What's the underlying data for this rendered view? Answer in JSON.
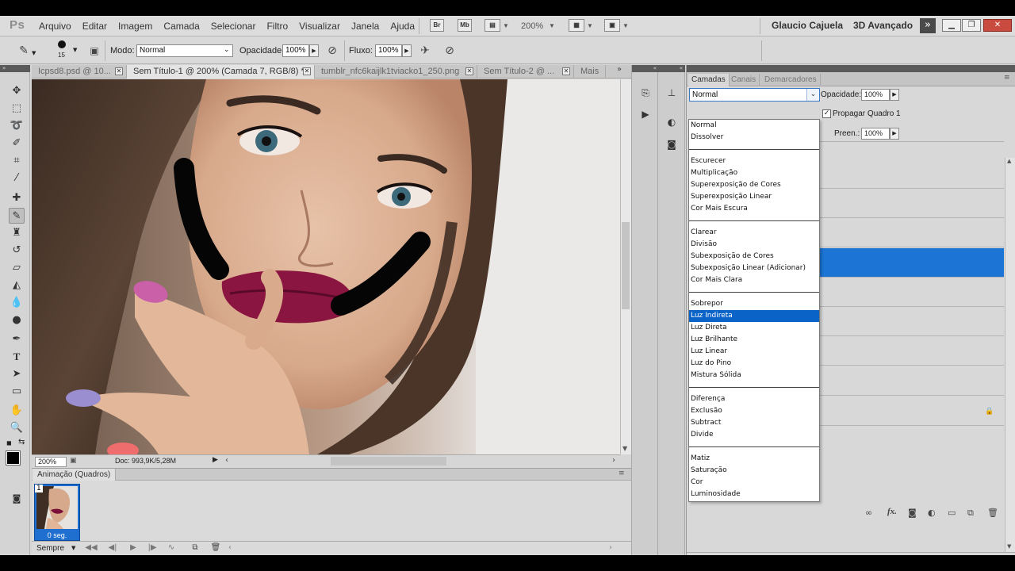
{
  "app": {
    "logo": "Ps"
  },
  "menubar": {
    "items": [
      "Arquivo",
      "Editar",
      "Imagem",
      "Camada",
      "Selecionar",
      "Filtro",
      "Visualizar",
      "Janela",
      "Ajuda"
    ],
    "bridge": "Br",
    "minibridge": "Mb",
    "zoom": "200%",
    "user": "Glaucio Cajuela",
    "workspace": "3D Avançado",
    "ws_more": "»"
  },
  "options": {
    "brush_size": "15",
    "mode_label": "Modo:",
    "mode_value": "Normal",
    "opacity_label": "Opacidade:",
    "opacity_value": "100%",
    "flow_label": "Fluxo:",
    "flow_value": "100%"
  },
  "doc_tabs": [
    "Icpsd8.psd @ 10...",
    "Sem Título-1 @ 200% (Camada 7, RGB/8) *",
    "tumblr_nfc6kaijlk1tviacko1_250.png",
    "Sem Título-2 @ ...",
    "Mais"
  ],
  "status": {
    "zoom": "200%",
    "doc": "Doc: 993,9K/5,28M"
  },
  "animation": {
    "title": "Animação (Quadros)",
    "frame_number": "1",
    "frame_delay": "0 seg.",
    "loop": "Sempre"
  },
  "layers_panel": {
    "tabs": [
      "Camadas",
      "Canais",
      "Demarcadores"
    ],
    "blend_mode": "Normal",
    "opacity_label": "Opacidade:",
    "opacity_value": "100%",
    "propagate_label": "Propagar Quadro 1",
    "fill_label": "Preen.:",
    "fill_value": "100%"
  },
  "blend_modes": {
    "groups": [
      [
        "Normal",
        "Dissolver"
      ],
      [
        "Escurecer",
        "Multiplicação",
        "Superexposição de Cores",
        "Superexposição Linear",
        "Cor Mais Escura"
      ],
      [
        "Clarear",
        "Divisão",
        "Subexposição de Cores",
        "Subexposição Linear (Adicionar)",
        "Cor Mais Clara"
      ],
      [
        "Sobrepor",
        "Luz Indireta",
        "Luz Direta",
        "Luz Brilhante",
        "Luz Linear",
        "Luz do Pino",
        "Mistura Sólida"
      ],
      [
        "Diferença",
        "Exclusão",
        "Subtract",
        "Divide"
      ],
      [
        "Matiz",
        "Saturação",
        "Cor",
        "Luminosidade"
      ]
    ],
    "selected": "Luz Indireta"
  },
  "colors": {
    "selection_blue": "#1c74d4",
    "dropdown_highlight": "#0a64c8",
    "foreground": "#000000",
    "background": "#ffffff"
  }
}
